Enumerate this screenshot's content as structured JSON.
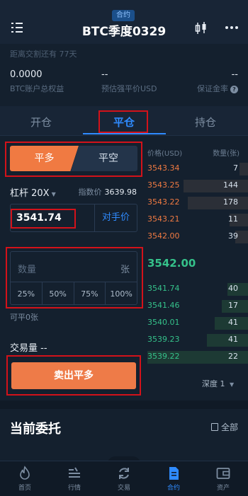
{
  "header": {
    "badge": "合约",
    "title": "BTC季度0329"
  },
  "delivery_notice": "距离交割还有 77天",
  "stats": [
    {
      "value": "0.0000",
      "label": "BTC账户总权益"
    },
    {
      "value": "--",
      "label": "预估强平价USD"
    },
    {
      "value": "--",
      "label": "保证金率"
    }
  ],
  "tabs": [
    {
      "label": "开仓",
      "active": false
    },
    {
      "label": "平仓",
      "active": true
    },
    {
      "label": "持仓",
      "active": false
    }
  ],
  "side": {
    "long": "平多",
    "short": "平空"
  },
  "leverage": {
    "label": "杠杆 20X"
  },
  "index_price": {
    "label": "指数价",
    "value": "3639.98"
  },
  "price_input": {
    "value": "3541.74",
    "counterparty_label": "对手价"
  },
  "quantity": {
    "placeholder": "数量",
    "unit": "张",
    "percents": [
      "25%",
      "50%",
      "75%",
      "100%"
    ]
  },
  "closeable": "可平0张",
  "volume": "交易量 --",
  "submit_label": "卖出平多",
  "orderbook": {
    "price_header": "价格(USD)",
    "qty_header": "数量(张)",
    "asks": [
      {
        "price": "3543.34",
        "qty": "7",
        "depth": 0.08
      },
      {
        "price": "3543.25",
        "qty": "144",
        "depth": 0.62
      },
      {
        "price": "3543.22",
        "qty": "178",
        "depth": 0.58
      },
      {
        "price": "3543.21",
        "qty": "11",
        "depth": 0.18
      },
      {
        "price": "3542.00",
        "qty": "39",
        "depth": 0.12
      }
    ],
    "last_price": "3542.00",
    "bids": [
      {
        "price": "3541.74",
        "qty": "40",
        "depth": 0.2
      },
      {
        "price": "3541.46",
        "qty": "17",
        "depth": 0.25
      },
      {
        "price": "3540.01",
        "qty": "41",
        "depth": 0.32
      },
      {
        "price": "3539.23",
        "qty": "41",
        "depth": 0.4
      },
      {
        "price": "3539.22",
        "qty": "22",
        "depth": 0.97
      }
    ],
    "depth_label": "深度 1"
  },
  "orders": {
    "title": "当前委托",
    "all_label": "全部"
  },
  "nav": [
    {
      "label": "首页",
      "icon": "fire-icon",
      "active": false
    },
    {
      "label": "行情",
      "icon": "market-icon",
      "active": false
    },
    {
      "label": "交易",
      "icon": "exchange-icon",
      "active": false
    },
    {
      "label": "合约",
      "icon": "contract-icon",
      "active": true
    },
    {
      "label": "资产",
      "icon": "wallet-icon",
      "active": false
    }
  ],
  "colors": {
    "accent": "#2f8bff",
    "ask": "#f07a42",
    "bid": "#35c18a",
    "highlight": "#d3121a"
  }
}
